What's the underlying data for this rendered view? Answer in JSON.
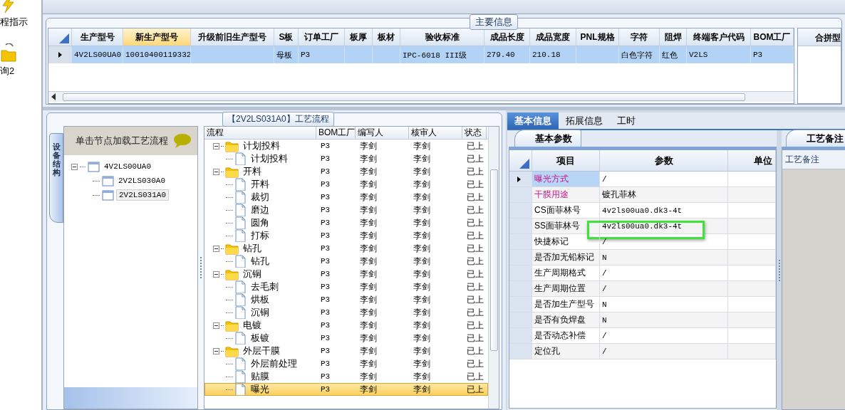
{
  "sidebar": {
    "items": [
      {
        "label": "程指示",
        "kind": "bolt"
      },
      {
        "label": "询2",
        "kind": "folder"
      }
    ]
  },
  "main_info": {
    "title": "主要信息",
    "columns": [
      {
        "label": "生产型号",
        "selected": false
      },
      {
        "label": "新生产型号",
        "selected": true
      },
      {
        "label": "升级前旧生产型号",
        "selected": false
      },
      {
        "label": "S板",
        "selected": false
      },
      {
        "label": "订单工厂",
        "selected": false
      },
      {
        "label": "板厚",
        "selected": false
      },
      {
        "label": "板材",
        "selected": false
      },
      {
        "label": "验收标准",
        "selected": false
      },
      {
        "label": "成品长度",
        "selected": false
      },
      {
        "label": "成品宽度",
        "selected": false
      },
      {
        "label": "PNL规格",
        "selected": false
      },
      {
        "label": "字符",
        "selected": false
      },
      {
        "label": "阻焊",
        "selected": false
      },
      {
        "label": "终端客户代码",
        "selected": false
      },
      {
        "label": "BOM工厂",
        "selected": false
      }
    ],
    "rows": [
      {
        "selected": true,
        "cells": [
          "4V2LS00UA0",
          "10010400119332",
          null,
          "母板",
          "P3",
          null,
          null,
          "IPC-6018 III级",
          "279.40",
          "210.18",
          null,
          "白色字符",
          "红色",
          "V2LS",
          "P3"
        ]
      }
    ],
    "side_panel": {
      "header": "合拼型"
    }
  },
  "process_tree": {
    "title": "【2V2LS031A0】工艺流程",
    "side_tab": "设备结构",
    "hint": "单击节点加载工艺流程",
    "nodes": [
      {
        "label": "4V2LS00UA0",
        "expanded": true,
        "selected": false,
        "children": [
          {
            "label": "2V2LS030A0",
            "selected": false
          },
          {
            "label": "2V2LS031A0",
            "selected": true
          }
        ]
      }
    ]
  },
  "flow": {
    "columns": [
      "流程",
      "BOM工厂",
      "编写人",
      "核审人",
      "状态"
    ],
    "rows": [
      {
        "label": "计划投料",
        "bom": "P3",
        "writer": "李剑",
        "reviewer": "李剑",
        "status": "已上",
        "selected": false,
        "expanded": true,
        "children": [
          {
            "label": "计划投料",
            "bom": "P3",
            "writer": "李剑",
            "reviewer": "李剑",
            "status": "已上",
            "selected": false
          }
        ]
      },
      {
        "label": "开料",
        "bom": "P3",
        "writer": "李剑",
        "reviewer": "李剑",
        "status": "已上",
        "selected": false,
        "expanded": true,
        "children": [
          {
            "label": "开料",
            "bom": "P3",
            "writer": "李剑",
            "reviewer": "李剑",
            "status": "已上",
            "selected": false
          },
          {
            "label": "裁切",
            "bom": "P3",
            "writer": "李剑",
            "reviewer": "李剑",
            "status": "已上",
            "selected": false
          },
          {
            "label": "磨边",
            "bom": "P3",
            "writer": "李剑",
            "reviewer": "李剑",
            "status": "已上",
            "selected": false
          },
          {
            "label": "圆角",
            "bom": "P3",
            "writer": "李剑",
            "reviewer": "李剑",
            "status": "已上",
            "selected": false
          },
          {
            "label": "打标",
            "bom": "P3",
            "writer": "李剑",
            "reviewer": "李剑",
            "status": "已上",
            "selected": false
          }
        ]
      },
      {
        "label": "钻孔",
        "bom": "P3",
        "writer": "李剑",
        "reviewer": "李剑",
        "status": "已上",
        "selected": false,
        "expanded": true,
        "children": [
          {
            "label": "钻孔",
            "bom": "P3",
            "writer": "李剑",
            "reviewer": "李剑",
            "status": "已上",
            "selected": false
          }
        ]
      },
      {
        "label": "沉铜",
        "bom": "P3",
        "writer": "李剑",
        "reviewer": "李剑",
        "status": "已上",
        "selected": false,
        "expanded": true,
        "children": [
          {
            "label": "去毛刺",
            "bom": "P3",
            "writer": "李剑",
            "reviewer": "李剑",
            "status": "已上",
            "selected": false
          },
          {
            "label": "烘板",
            "bom": "P3",
            "writer": "李剑",
            "reviewer": "李剑",
            "status": "已上",
            "selected": false
          },
          {
            "label": "沉铜",
            "bom": "P3",
            "writer": "李剑",
            "reviewer": "李剑",
            "status": "已上",
            "selected": false
          }
        ]
      },
      {
        "label": "电镀",
        "bom": "P3",
        "writer": "李剑",
        "reviewer": "李剑",
        "status": "已上",
        "selected": false,
        "expanded": true,
        "children": [
          {
            "label": "板镀",
            "bom": "P3",
            "writer": "李剑",
            "reviewer": "李剑",
            "status": "已上",
            "selected": false
          }
        ]
      },
      {
        "label": "外层干膜",
        "bom": "P3",
        "writer": "李剑",
        "reviewer": "李剑",
        "status": "已上",
        "selected": false,
        "expanded": true,
        "children": [
          {
            "label": "外层前处理",
            "bom": "P3",
            "writer": "李剑",
            "reviewer": "李剑",
            "status": "已上",
            "selected": false
          },
          {
            "label": "贴膜",
            "bom": "P3",
            "writer": "李剑",
            "reviewer": "李剑",
            "status": "已上",
            "selected": false
          },
          {
            "label": "曝光",
            "bom": "P3",
            "writer": "李剑",
            "reviewer": "李剑",
            "status": "已上",
            "selected": true
          }
        ]
      }
    ]
  },
  "details": {
    "tabs": [
      {
        "label": "基本信息",
        "selected": true
      },
      {
        "label": "拓展信息",
        "selected": false
      },
      {
        "label": "工时",
        "selected": false
      }
    ],
    "subtab": "基本参数",
    "columns": [
      "项目",
      "参数",
      "单位"
    ],
    "rows": [
      {
        "item": "曝光方式",
        "value": "/",
        "kind": "required",
        "selected": true,
        "highlighted": false
      },
      {
        "item": "干膜用途",
        "value": "镀孔菲林",
        "kind": "required",
        "selected": false,
        "highlighted": false
      },
      {
        "item": "CS面菲林号",
        "value": "4v2ls00ua0.dk3-4t",
        "kind": "normal",
        "selected": false,
        "highlighted": false
      },
      {
        "item": "SS面菲林号",
        "value": "4v2ls00ua0.dk3-4t",
        "kind": "normal",
        "selected": false,
        "highlighted": true
      },
      {
        "item": "快捷标记",
        "value": "/",
        "kind": "normal",
        "selected": false,
        "highlighted": false
      },
      {
        "item": "是否加无铅标记",
        "value": "N",
        "kind": "normal",
        "selected": false,
        "highlighted": false
      },
      {
        "item": "生产周期格式",
        "value": "/",
        "kind": "normal",
        "selected": false,
        "highlighted": false
      },
      {
        "item": "生产周期位置",
        "value": "/",
        "kind": "normal",
        "selected": false,
        "highlighted": false
      },
      {
        "item": "是否加生产型号",
        "value": "N",
        "kind": "normal",
        "selected": false,
        "highlighted": false
      },
      {
        "item": "是否有负焊盘",
        "value": "N",
        "kind": "normal",
        "selected": false,
        "highlighted": false
      },
      {
        "item": "是否动态补偿",
        "value": "/",
        "kind": "normal",
        "selected": false,
        "highlighted": false
      },
      {
        "item": "定位孔",
        "value": "/",
        "kind": "normal",
        "selected": false,
        "highlighted": false
      }
    ],
    "remarks": {
      "tab": "工艺备注",
      "header": "工艺备注"
    }
  }
}
